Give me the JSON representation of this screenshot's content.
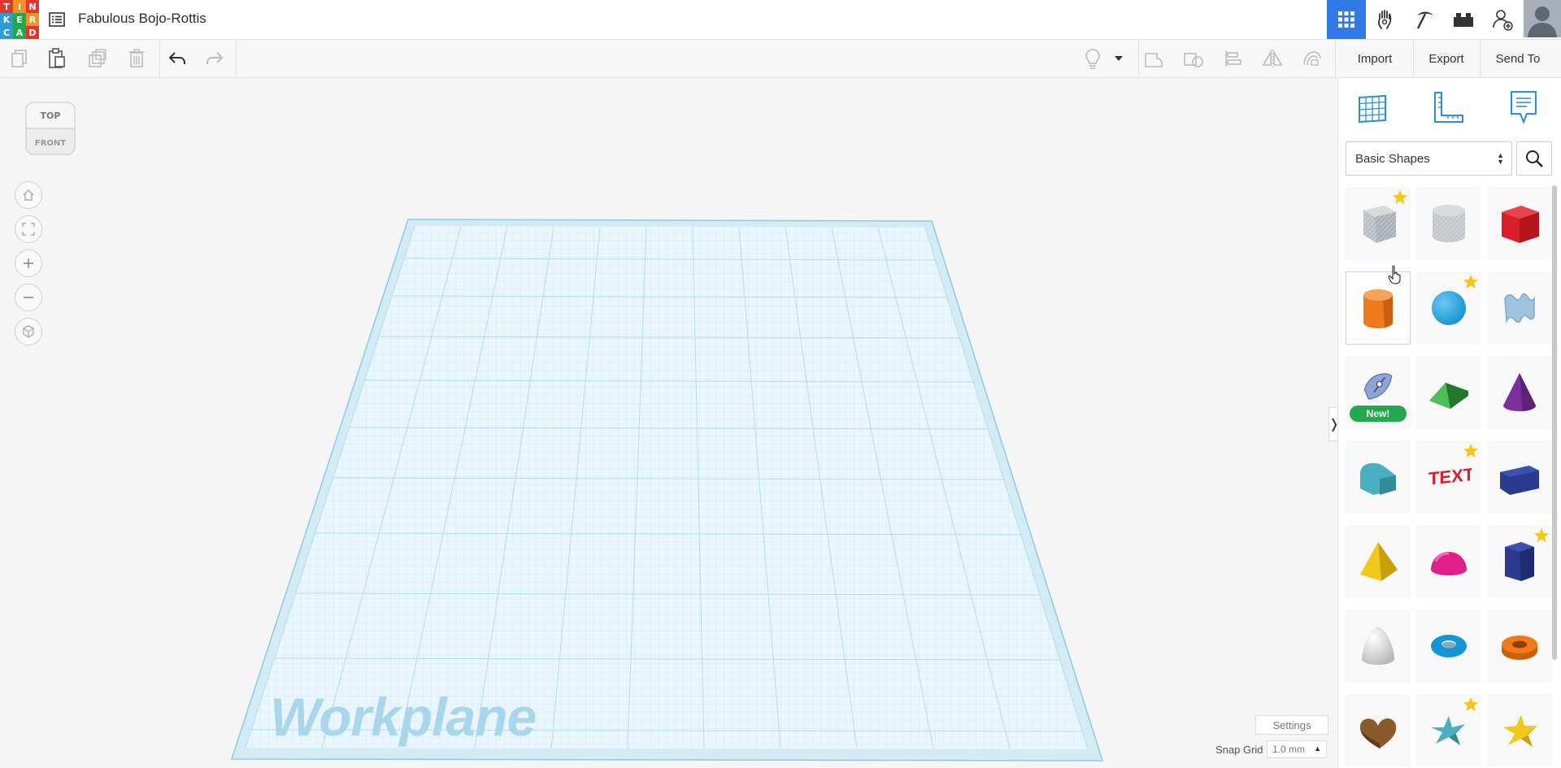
{
  "app": {
    "logo_letters": [
      "T",
      "I",
      "N",
      "K",
      "E",
      "R",
      "C",
      "A",
      "D"
    ],
    "logo_colors": [
      "#e4372c",
      "#f29222",
      "#e4372c",
      "#2e9bd6",
      "#23a94d",
      "#f29222",
      "#2e9bd6",
      "#23a94d",
      "#e4372c"
    ],
    "title": "Fabulous Bojo-Rottis"
  },
  "topbar_right": [
    {
      "name": "3d-design-grid-icon",
      "active": true
    },
    {
      "name": "circuits-hand-icon",
      "active": false
    },
    {
      "name": "codeblocks-pickaxe-icon",
      "active": false
    },
    {
      "name": "lego-brick-icon",
      "active": false
    },
    {
      "name": "invite-user-icon",
      "active": false
    }
  ],
  "toolbar": {
    "icons": [
      "copy-icon",
      "paste-icon",
      "duplicate-icon",
      "delete-icon",
      "undo-icon",
      "redo-icon",
      "note-lightbulb-icon",
      "dropdown-caret-icon",
      "group-icon",
      "ungroup-icon",
      "align-icon",
      "mirror-icon",
      "cruise-icon"
    ],
    "import_label": "Import",
    "export_label": "Export",
    "send_to_label": "Send To"
  },
  "viewcube": {
    "top_label": "TOP",
    "front_label": "FRONT"
  },
  "nav_buttons": [
    "home-view-icon",
    "fit-view-icon",
    "zoom-in-icon",
    "zoom-out-icon",
    "perspective-icon"
  ],
  "workplane": {
    "label": "Workplane",
    "color": "#a9d6ea"
  },
  "bottom": {
    "settings_label": "Settings",
    "snap_grid_label": "Snap Grid",
    "snap_grid_value": "1.0 mm"
  },
  "panel": {
    "tools": [
      "workplane-grid-icon",
      "ruler-icon",
      "notes-icon"
    ],
    "category": "Basic Shapes",
    "new_badge": "New!",
    "shapes": [
      {
        "name": "box-hole",
        "color": "#b9bec4",
        "starred": true
      },
      {
        "name": "cylinder-hole",
        "color": "#c2c6ca",
        "starred": false
      },
      {
        "name": "box",
        "color": "#d8202a",
        "starred": false
      },
      {
        "name": "cylinder",
        "color": "#ee7a1a",
        "starred": false
      },
      {
        "name": "sphere",
        "color": "#1496d4",
        "starred": true
      },
      {
        "name": "scribble",
        "color": "#9fc3de",
        "starred": false
      },
      {
        "name": "shape-generator",
        "color": "#8fa3d6",
        "starred": false,
        "badge": true
      },
      {
        "name": "roof",
        "color": "#34a43c",
        "starred": false
      },
      {
        "name": "cone",
        "color": "#7b2f9e",
        "starred": false
      },
      {
        "name": "round-roof",
        "color": "#4ab0c1",
        "starred": false
      },
      {
        "name": "text",
        "color": "#d8202a",
        "starred": true
      },
      {
        "name": "wedge",
        "color": "#2a3b8f",
        "starred": false
      },
      {
        "name": "pyramid",
        "color": "#f2c81a",
        "starred": false
      },
      {
        "name": "half-sphere",
        "color": "#e01f8a",
        "starred": false
      },
      {
        "name": "polygon",
        "color": "#2a3b8f",
        "starred": true
      },
      {
        "name": "paraboloid",
        "color": "#dcdcdc",
        "starred": false
      },
      {
        "name": "torus",
        "color": "#1496d4",
        "starred": false
      },
      {
        "name": "tube",
        "color": "#ee7a1a",
        "starred": false
      },
      {
        "name": "heart",
        "color": "#8b5a2b",
        "starred": false
      },
      {
        "name": "star",
        "color": "#4ab0c1",
        "starred": true
      },
      {
        "name": "star-yellow",
        "color": "#f2c81a",
        "starred": false
      }
    ]
  }
}
